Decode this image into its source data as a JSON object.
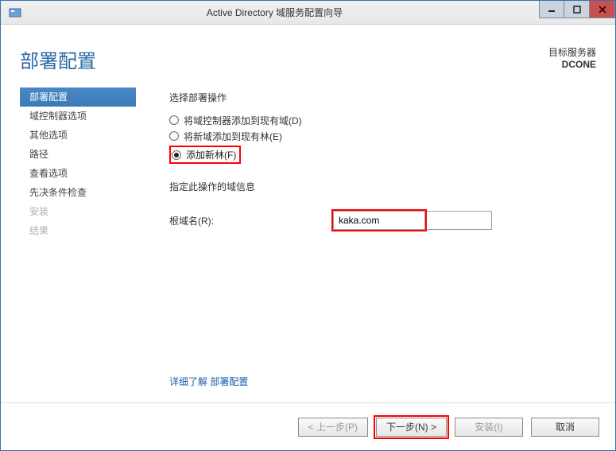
{
  "window": {
    "title": "Active Directory 域服务配置向导"
  },
  "header": {
    "page_title": "部署配置",
    "target_label": "目标服务器",
    "target_name": "DCONE"
  },
  "sidebar": {
    "items": [
      {
        "label": "部署配置",
        "state": "selected"
      },
      {
        "label": "域控制器选项",
        "state": "normal"
      },
      {
        "label": "其他选项",
        "state": "normal"
      },
      {
        "label": "路径",
        "state": "normal"
      },
      {
        "label": "查看选项",
        "state": "normal"
      },
      {
        "label": "先决条件检查",
        "state": "normal"
      },
      {
        "label": "安装",
        "state": "disabled"
      },
      {
        "label": "结果",
        "state": "disabled"
      }
    ]
  },
  "form": {
    "operation_label": "选择部署操作",
    "radios": [
      {
        "label": "将域控制器添加到现有域(D)",
        "checked": false
      },
      {
        "label": "将新域添加到现有林(E)",
        "checked": false
      },
      {
        "label": "添加新林(F)",
        "checked": true
      }
    ],
    "domain_info_label": "指定此操作的域信息",
    "root_domain_label": "根域名(R):",
    "root_domain_value": "kaka.com"
  },
  "link": {
    "text": "详细了解 部署配置"
  },
  "footer": {
    "prev": "< 上一步(P)",
    "next": "下一步(N) >",
    "install": "安装(I)",
    "cancel": "取消"
  }
}
